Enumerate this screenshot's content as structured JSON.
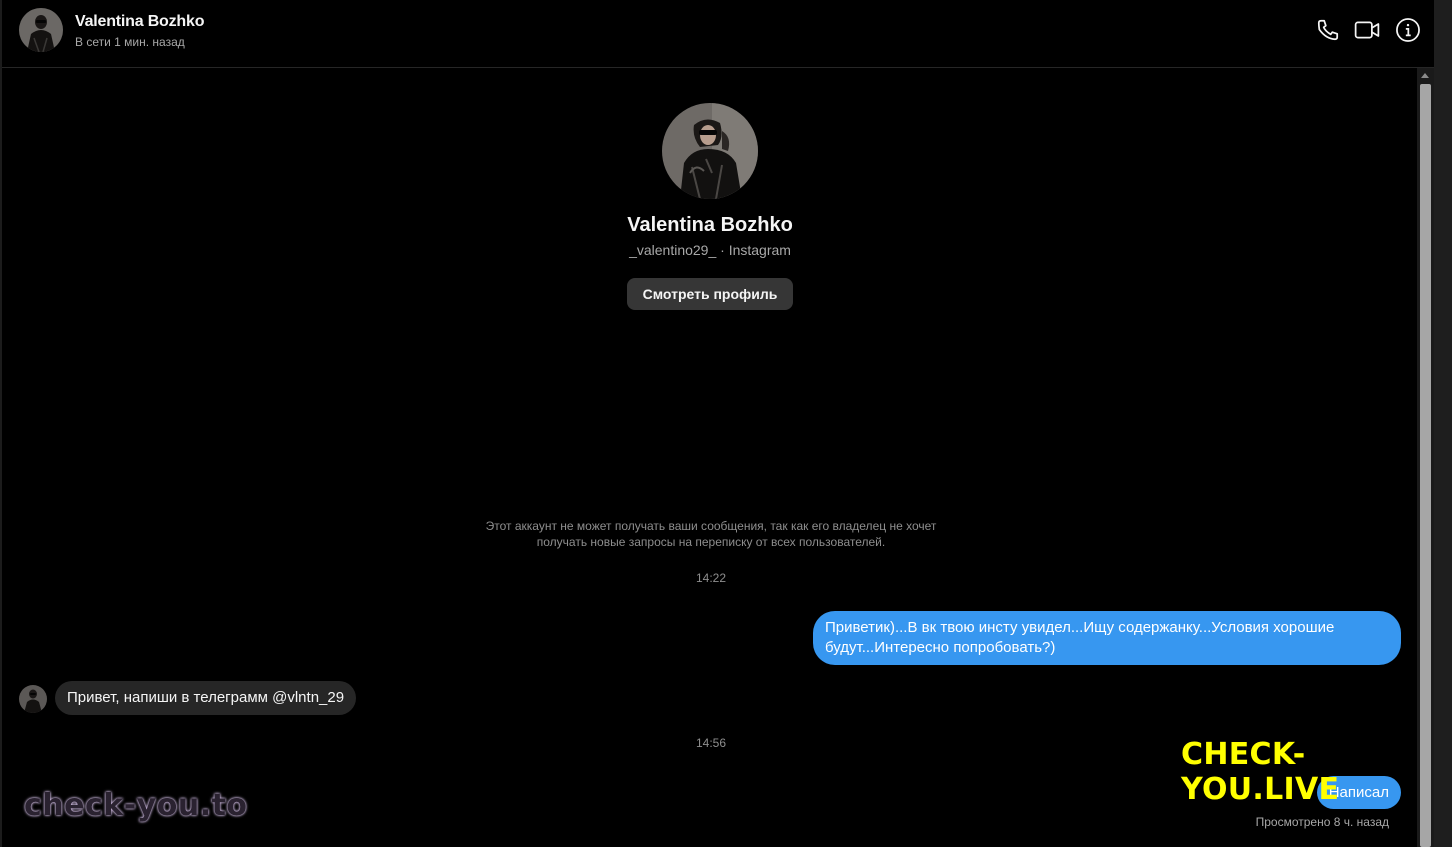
{
  "header": {
    "name": "Valentina Bozhko",
    "status": "В сети 1 мин. назад",
    "icons": [
      "phone-icon",
      "video-icon",
      "info-icon"
    ]
  },
  "profile": {
    "name": "Valentina Bozhko",
    "subtitle": "_valentino29_ · Instagram",
    "button_label": "Смотреть профиль"
  },
  "notice": "Этот аккаунт не может получать ваши сообщения, так как его владелец не хочет получать новые запросы на переписку от всех пользователей.",
  "messages": [
    {
      "type": "timestamp",
      "text": "14:22"
    },
    {
      "type": "outgoing",
      "text": "Приветик)...В вк твою инсту увидел...Ищу содержанку...Условия хорошие будут...Интересно попробовать?)"
    },
    {
      "type": "incoming",
      "text": "Привет, напиши в телеграмм @vlntn_29"
    },
    {
      "type": "timestamp",
      "text": "14:56"
    },
    {
      "type": "outgoing",
      "text": "Написал"
    }
  ],
  "seen_status": "Просмотрено 8 ч. назад",
  "watermarks": {
    "top": "CHECK-YOU.LIVE",
    "bottom": "check-you.to"
  },
  "colors": {
    "background": "#000000",
    "outgoing_bubble": "#3797f0",
    "incoming_bubble": "#262626",
    "button": "#363636",
    "watermark_yellow": "#ffff00"
  }
}
